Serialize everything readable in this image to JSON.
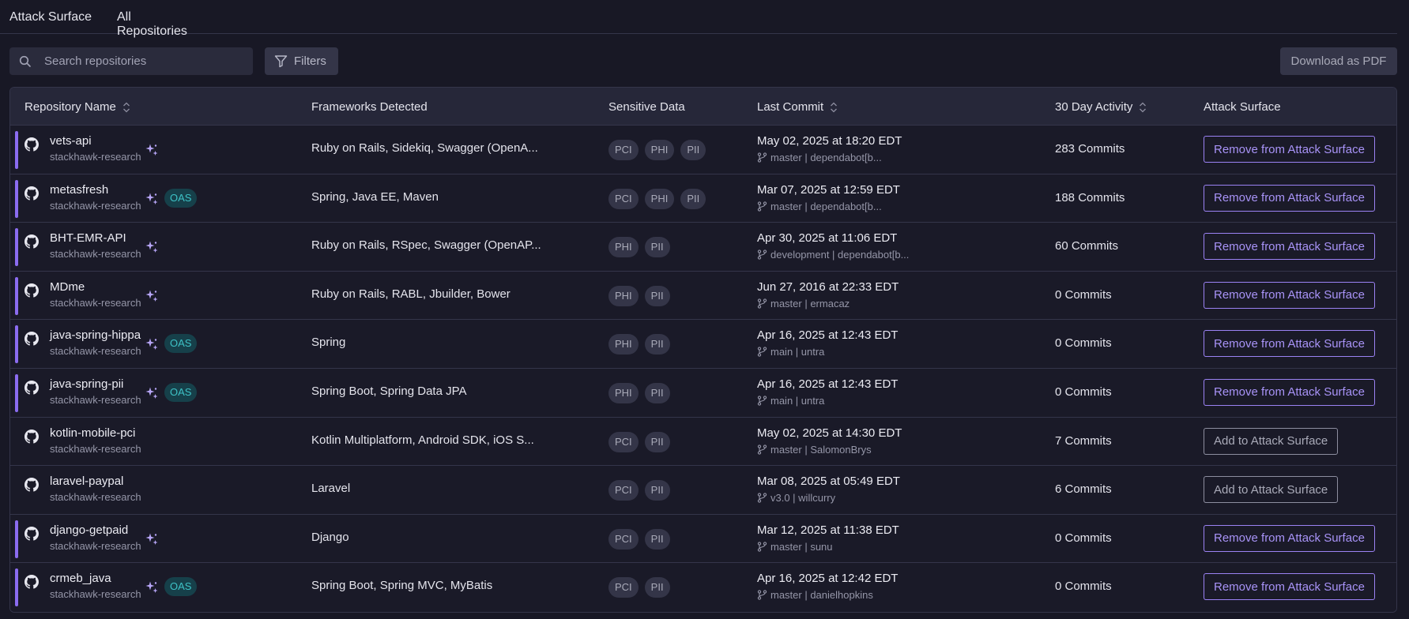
{
  "tabs": [
    {
      "label": "Attack Surface",
      "active": false
    },
    {
      "label": "All Repositories",
      "active": true
    }
  ],
  "toolbar": {
    "search_placeholder": "Search repositories",
    "filters_label": "Filters",
    "download_label": "Download as PDF"
  },
  "table": {
    "headers": {
      "name": "Repository Name",
      "frameworks": "Frameworks Detected",
      "sensitive": "Sensitive Data",
      "commit": "Last Commit",
      "activity": "30 Day Activity",
      "attack": "Attack Surface"
    },
    "rows": [
      {
        "name": "vets-api",
        "org": "stackhawk-research",
        "in_surface": true,
        "ai": true,
        "oas": "",
        "frameworks": "Ruby on Rails, Sidekiq, Swagger (OpenA...",
        "tags": [
          "PCI",
          "PHI",
          "PII"
        ],
        "commit_date": "May 02, 2025 at 18:20 EDT",
        "commit_meta": "master | dependabot[b...",
        "activity": "283 Commits",
        "action": "Remove from Attack Surface"
      },
      {
        "name": "metasfresh",
        "org": "stackhawk-research",
        "in_surface": true,
        "ai": true,
        "oas": "OAS",
        "frameworks": "Spring, Java EE, Maven",
        "tags": [
          "PCI",
          "PHI",
          "PII"
        ],
        "commit_date": "Mar 07, 2025 at 12:59 EDT",
        "commit_meta": "master | dependabot[b...",
        "activity": "188 Commits",
        "action": "Remove from Attack Surface"
      },
      {
        "name": "BHT-EMR-API",
        "org": "stackhawk-research",
        "in_surface": true,
        "ai": true,
        "oas": "",
        "frameworks": "Ruby on Rails, RSpec, Swagger (OpenAP...",
        "tags": [
          "PHI",
          "PII"
        ],
        "commit_date": "Apr 30, 2025 at 11:06 EDT",
        "commit_meta": "development | dependabot[b...",
        "activity": "60 Commits",
        "action": "Remove from Attack Surface"
      },
      {
        "name": "MDme",
        "org": "stackhawk-research",
        "in_surface": true,
        "ai": true,
        "oas": "",
        "frameworks": "Ruby on Rails, RABL, Jbuilder, Bower",
        "tags": [
          "PHI",
          "PII"
        ],
        "commit_date": "Jun 27, 2016 at 22:33 EDT",
        "commit_meta": "master | ermacaz",
        "activity": "0 Commits",
        "action": "Remove from Attack Surface"
      },
      {
        "name": "java-spring-hippa",
        "org": "stackhawk-research",
        "in_surface": true,
        "ai": true,
        "oas": "OAS",
        "frameworks": "Spring",
        "tags": [
          "PHI",
          "PII"
        ],
        "commit_date": "Apr 16, 2025 at 12:43 EDT",
        "commit_meta": "main | untra",
        "activity": "0 Commits",
        "action": "Remove from Attack Surface"
      },
      {
        "name": "java-spring-pii",
        "org": "stackhawk-research",
        "in_surface": true,
        "ai": true,
        "oas": "OAS",
        "frameworks": "Spring Boot, Spring Data JPA",
        "tags": [
          "PHI",
          "PII"
        ],
        "commit_date": "Apr 16, 2025 at 12:43 EDT",
        "commit_meta": "main | untra",
        "activity": "0 Commits",
        "action": "Remove from Attack Surface"
      },
      {
        "name": "kotlin-mobile-pci",
        "org": "stackhawk-research",
        "in_surface": false,
        "ai": false,
        "oas": "",
        "frameworks": "Kotlin Multiplatform, Android SDK, iOS S...",
        "tags": [
          "PCI",
          "PII"
        ],
        "commit_date": "May 02, 2025 at 14:30 EDT",
        "commit_meta": "master | SalomonBrys",
        "activity": "7 Commits",
        "action": "Add to Attack Surface"
      },
      {
        "name": "laravel-paypal",
        "org": "stackhawk-research",
        "in_surface": false,
        "ai": false,
        "oas": "",
        "frameworks": "Laravel",
        "tags": [
          "PCI",
          "PII"
        ],
        "commit_date": "Mar 08, 2025 at 05:49 EDT",
        "commit_meta": "v3.0 | willcurry",
        "activity": "6 Commits",
        "action": "Add to Attack Surface"
      },
      {
        "name": "django-getpaid",
        "org": "stackhawk-research",
        "in_surface": true,
        "ai": true,
        "oas": "",
        "frameworks": "Django",
        "tags": [
          "PCI",
          "PII"
        ],
        "commit_date": "Mar 12, 2025 at 11:38 EDT",
        "commit_meta": "master | sunu",
        "activity": "0 Commits",
        "action": "Remove from Attack Surface"
      },
      {
        "name": "crmeb_java",
        "org": "stackhawk-research",
        "in_surface": true,
        "ai": true,
        "oas": "OAS",
        "frameworks": "Spring Boot, Spring MVC, MyBatis",
        "tags": [
          "PCI",
          "PII"
        ],
        "commit_date": "Apr 16, 2025 at 12:42 EDT",
        "commit_meta": "master | danielhopkins",
        "activity": "0 Commits",
        "action": "Remove from Attack Surface"
      }
    ]
  },
  "colors": {
    "accent_purple": "#8b6cf0",
    "tab_underline": "#2fc2cf",
    "oas_teal": "#3ec2c6"
  },
  "icons": {
    "search": "search-icon",
    "filter": "filter-icon",
    "sort": "sort-icon",
    "repo": "github-icon",
    "ai": "sparkle-icon",
    "branch": "git-branch-icon"
  }
}
